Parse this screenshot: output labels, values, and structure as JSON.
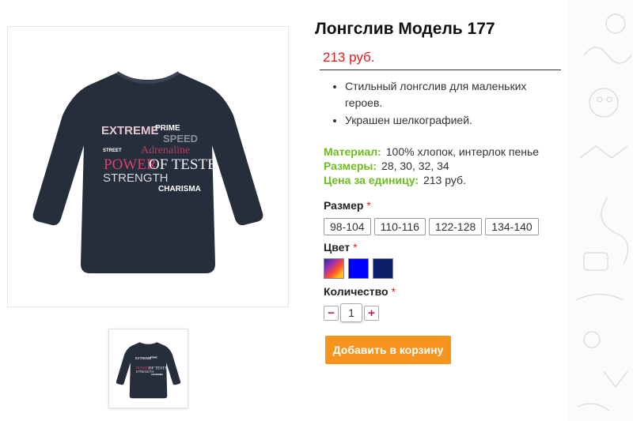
{
  "product": {
    "title": "Лонгслив Модель 177",
    "price": "213 руб.",
    "features": [
      "Стильный лонгслив для маленьких героев.",
      "Украшен шелкографией."
    ],
    "specs": {
      "material_label": "Материал:",
      "material_value": "100% хлопок, интерлок пенье",
      "sizes_label": "Размеры:",
      "sizes_value": "28, 30, 32, 34",
      "unit_price_label": "Цена за единицу:",
      "unit_price_value": "213 руб."
    },
    "image_print_text": [
      "EXTREME",
      "PRIME",
      "SPEED",
      "STREET",
      "Adrenaline",
      "POWER",
      "OF TESTE",
      "STRENGTH",
      "CHARISMA"
    ]
  },
  "options": {
    "size_label": "Размер",
    "required_mark": "*",
    "sizes": [
      "98-104",
      "110-116",
      "122-128",
      "134-140"
    ],
    "color_label": "Цвет",
    "colors": [
      "multicolor",
      "#0000ff",
      "#0d1f6b"
    ],
    "quantity_label": "Количество",
    "quantity_value": "1",
    "minus_label": "−",
    "plus_label": "+"
  },
  "actions": {
    "add_to_cart": "Добавить в корзину"
  },
  "theme": {
    "accent": "#f7941d",
    "price_color": "#e01b1b",
    "spec_label_color": "#6dbd1f"
  }
}
